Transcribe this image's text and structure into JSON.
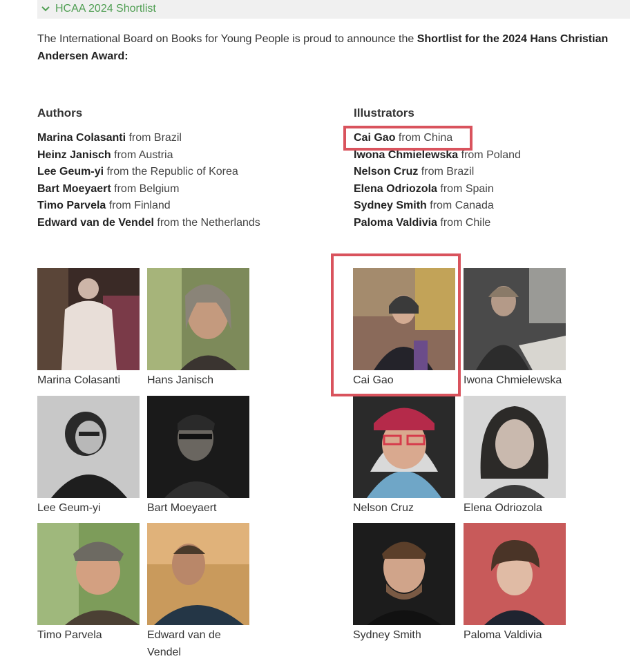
{
  "section": {
    "toggle_label": "HCAA 2024 Shortlist"
  },
  "intro": {
    "text": "The International Board on Books for Young People is proud to announce the ",
    "bold": "Shortlist for the 2024 Hans Christian Andersen Award:"
  },
  "authors": {
    "heading": "Authors",
    "items": [
      {
        "name": "Marina Colasanti",
        "from": " from Brazil"
      },
      {
        "name": "Heinz Janisch",
        "from": " from Austria"
      },
      {
        "name": "Lee Geum-yi",
        "from": " from the Republic of Korea"
      },
      {
        "name": "Bart Moeyaert",
        "from": " from Belgium"
      },
      {
        "name": "Timo Parvela",
        "from": " from Finland"
      },
      {
        "name": "Edward van de Vendel",
        "from": " from the Netherlands"
      }
    ]
  },
  "illustrators": {
    "heading": "Illustrators",
    "items": [
      {
        "name": "Cai Gao",
        "from": " from China"
      },
      {
        "name": "Iwona Chmielewska",
        "from": " from Poland"
      },
      {
        "name": "Nelson Cruz",
        "from": " from Brazil"
      },
      {
        "name": "Elena Odriozola",
        "from": " from Spain"
      },
      {
        "name": "Sydney Smith",
        "from": " from Canada"
      },
      {
        "name": "Paloma Valdivia",
        "from": " from Chile"
      }
    ]
  },
  "gallery": {
    "captions": [
      "Marina Colasanti",
      "Hans Janisch",
      "Cai Gao",
      "Iwona Chmielewska",
      "Lee Geum-yi",
      "Bart Moeyaert",
      "Nelson Cruz",
      "Elena Odriozola",
      "Timo Parvela",
      "Edward van de Vendel",
      "Sydney Smith",
      "Paloma Valdivia"
    ]
  },
  "colors": {
    "toggle_green": "#4f9e52",
    "highlight_red": "#d9535d",
    "topbar_bg": "#f0f0f0"
  }
}
